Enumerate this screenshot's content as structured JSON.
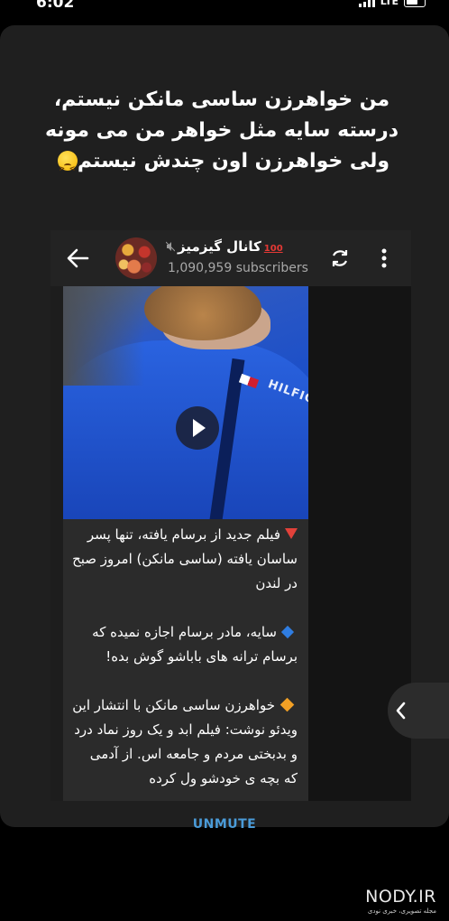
{
  "status_bar": {
    "time": "6:02",
    "network": "LTE"
  },
  "caption": {
    "line1": "من خواهرزن ساسی مانکن نیستم،",
    "line2": "درسته سایه مثل خواهر من می مونه",
    "line3": "ولی خواهرزن اون چندش نیستم"
  },
  "channel": {
    "name": "کانال گیزمیز",
    "badge": "100",
    "subscribers": "1,090,959 subscribers"
  },
  "video": {
    "overlay_text": "HILFIG"
  },
  "post": {
    "para1": "فیلم جدید از برسام یافته، تنها پسر ساسان یافته (ساسی مانکن) امروز صبح در لندن",
    "para2": "سایه، مادر برسام اجازه نمیده که برسام ترانه های باباشو گوش بده!",
    "para3": "خواهرزن ساسی مانکن با انتشار این ویدئو نوشت: فیلم ابد و یک روز نماد درد و بدبختی مردم و جامعه اس. از آدمی که بچه ی خودشو ول کرده"
  },
  "unmute_label": "UNMUTE",
  "watermark": {
    "main": "NODY.IR",
    "sub": "مجله تصویری، خبری نودی"
  },
  "colors": {
    "card_bg": "#1f1f1f",
    "accent_blue": "#4a9bd8",
    "badge_red": "#e53935"
  }
}
